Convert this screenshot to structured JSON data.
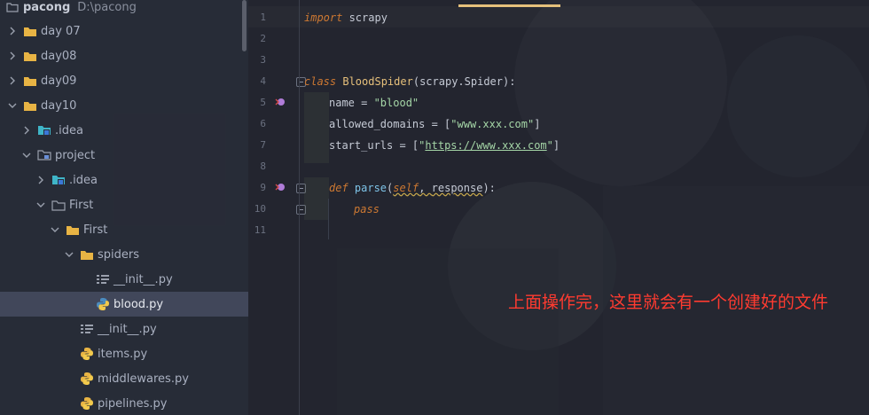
{
  "sidebar": {
    "root": {
      "name": "pacong",
      "path": "D:\\pacong"
    },
    "items": [
      {
        "label": "day 07"
      },
      {
        "label": "day08"
      },
      {
        "label": "day09"
      },
      {
        "label": "day10"
      },
      {
        "label": ".idea"
      },
      {
        "label": "project"
      },
      {
        "label": ".idea"
      },
      {
        "label": "First"
      },
      {
        "label": "First"
      },
      {
        "label": "spiders"
      },
      {
        "label": "__init__.py"
      },
      {
        "label": "blood.py"
      },
      {
        "label": "__init__.py"
      },
      {
        "label": "items.py"
      },
      {
        "label": "middlewares.py"
      },
      {
        "label": "pipelines.py"
      }
    ]
  },
  "editor": {
    "line_numbers": [
      "1",
      "2",
      "3",
      "4",
      "5",
      "6",
      "7",
      "8",
      "9",
      "10",
      "11"
    ],
    "code": {
      "l1_kw": "import",
      "l1_rest": " scrapy",
      "l4_kw": "class",
      "l4_cls": "BloodSpider",
      "l4_rest": "(scrapy.Spider):",
      "l5_name": "name = ",
      "l5_val": "\"blood\"",
      "l6_name": "allowed_domains = [",
      "l6_val": "\"www.xxx.com\"",
      "l6_end": "]",
      "l7_name": "start_urls = [",
      "l7_q1": "\"",
      "l7_url": "https://www.xxx.com",
      "l7_q2": "\"",
      "l7_end": "]",
      "l9_kw": "def",
      "l9_fn": " parse",
      "l9_p1": "(",
      "l9_self": "self",
      "l9_sep": ", ",
      "l9_param": "response",
      "l9_end": "):",
      "l10_kw": "pass"
    }
  },
  "annotation": "上面操作完，这里就会有一个创建好的文件",
  "colors": {
    "background": "#23252f",
    "sidebar": "#282c38",
    "selected_row": "#41475a",
    "keyword": "#cc7832",
    "string": "#a5d6a7",
    "class_name": "#e6c07b",
    "annotation": "#ff3b30"
  }
}
